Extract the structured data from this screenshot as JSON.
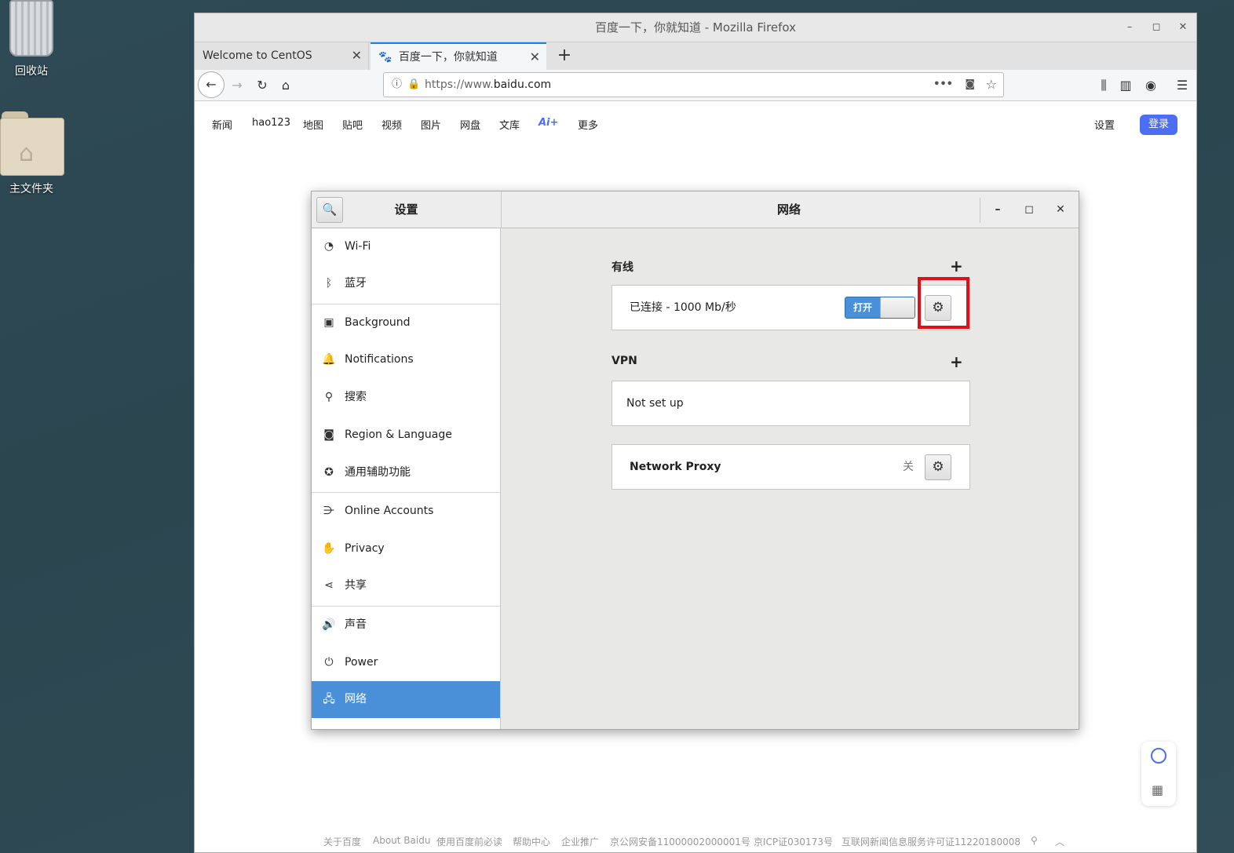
{
  "desktop": {
    "trash_label": "回收站",
    "home_label": "主文件夹"
  },
  "firefox": {
    "window_title": "百度一下，你就知道 - Mozilla Firefox",
    "tabs": [
      {
        "label": "Welcome to CentOS"
      },
      {
        "label": "百度一下，你就知道"
      }
    ],
    "url_prefix": "https://www.",
    "url_domain": "baidu.com"
  },
  "baidu": {
    "nav_links": [
      "新闻",
      "hao123",
      "地图",
      "贴吧",
      "视频",
      "图片",
      "网盘",
      "文库",
      "Ai+",
      "更多"
    ],
    "settings_label": "设置",
    "login_label": "登录",
    "footer_links": [
      "关于百度",
      "About Baidu",
      "使用百度前必读",
      "帮助中心",
      "企业推广",
      "京公网安备11000002000001号",
      "京ICP证030173号",
      "互联网新闻信息服务许可证11220180008"
    ]
  },
  "settings": {
    "left_title": "设置",
    "right_title": "网络",
    "sidebar": [
      {
        "label": "Wi-Fi",
        "icon": "wifi-icon"
      },
      {
        "label": "蓝牙",
        "icon": "bluetooth-icon"
      },
      {
        "label": "Background",
        "icon": "background-icon"
      },
      {
        "label": "Notifications",
        "icon": "bell-icon"
      },
      {
        "label": "搜索",
        "icon": "search-icon"
      },
      {
        "label": "Region & Language",
        "icon": "region-icon"
      },
      {
        "label": "通用辅助功能",
        "icon": "accessibility-icon"
      },
      {
        "label": "Online Accounts",
        "icon": "online-accounts-icon"
      },
      {
        "label": "Privacy",
        "icon": "hand-icon"
      },
      {
        "label": "共享",
        "icon": "share-icon"
      },
      {
        "label": "声音",
        "icon": "speaker-icon"
      },
      {
        "label": "Power",
        "icon": "power-icon"
      },
      {
        "label": "网络",
        "icon": "network-icon",
        "active": true
      }
    ],
    "wired": {
      "title": "有线",
      "status": "已连接 - 1000 Mb/秒",
      "toggle_label": "打开"
    },
    "vpn": {
      "title": "VPN",
      "status": "Not set up"
    },
    "proxy": {
      "label": "Network Proxy",
      "state": "关"
    },
    "highlight_color": "#e0101a",
    "accent_color": "#4a90d9"
  }
}
